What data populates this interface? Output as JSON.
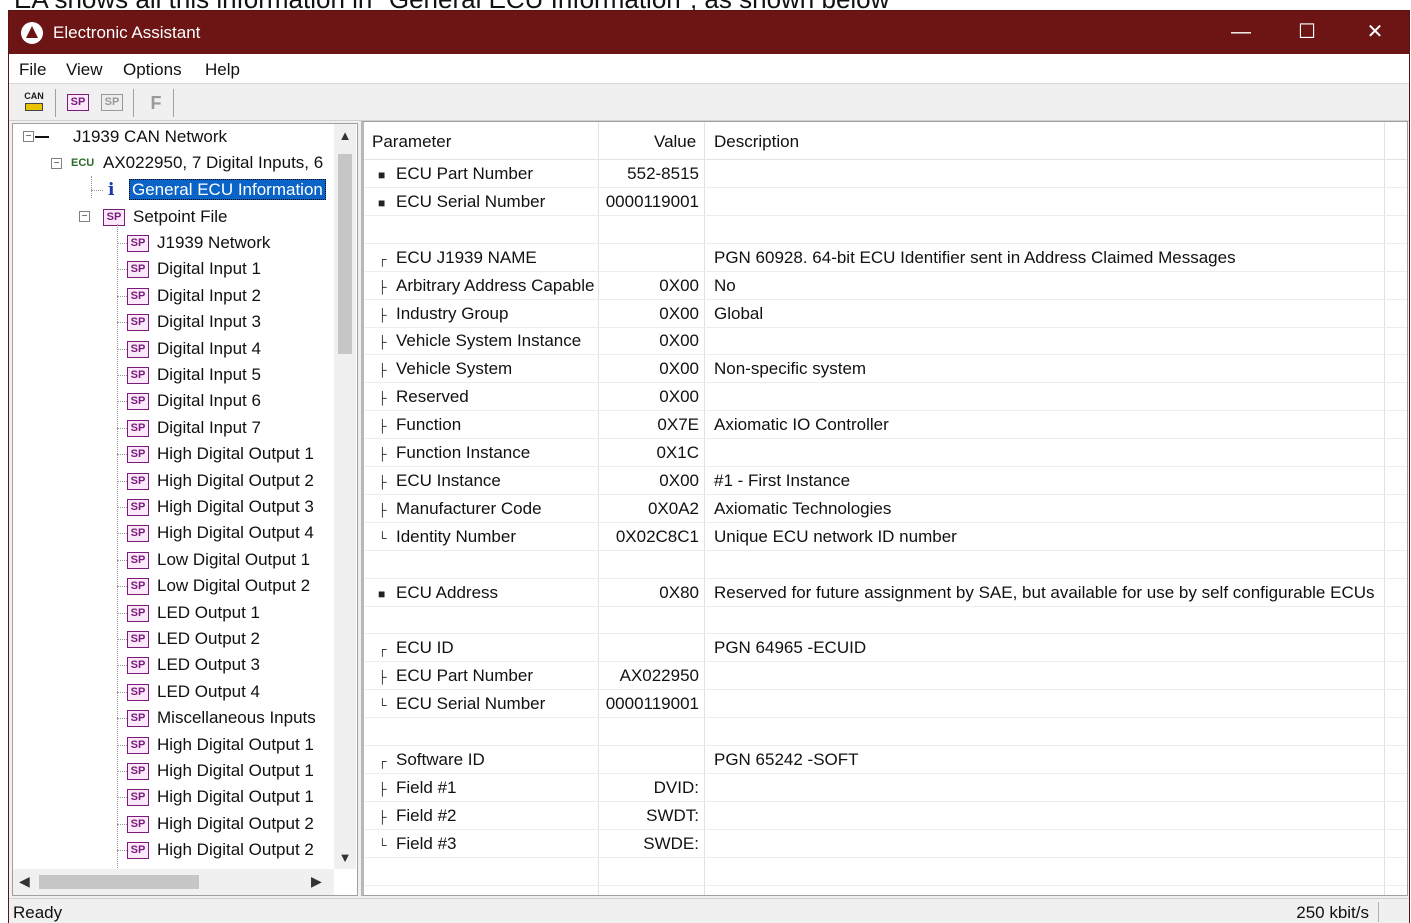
{
  "caption": "EA shows all this information in \"General ECU Information\", as shown below",
  "window": {
    "title": "Electronic Assistant",
    "minimize": "—",
    "maximize": "☐",
    "close": "✕"
  },
  "menu": [
    "File",
    "View",
    "Options",
    "Help"
  ],
  "toolbar": {
    "can_label": "CAN",
    "sp_label": "SP",
    "f_label": "F"
  },
  "tree": {
    "root": "J1939 CAN Network",
    "ecu_tag": "ECU",
    "ecu": "AX022950, 7 Digital Inputs, 6",
    "info_icon": "i",
    "general": "General ECU Information",
    "setpoint_file": "Setpoint File",
    "sp_icon": "SP",
    "items": [
      "J1939 Network",
      "Digital Input 1",
      "Digital Input 2",
      "Digital Input 3",
      "Digital Input 4",
      "Digital Input 5",
      "Digital Input 6",
      "Digital Input 7",
      "High Digital Output 1",
      "High Digital Output 2",
      "High Digital Output 3",
      "High Digital Output 4",
      "Low Digital Output 1",
      "Low Digital Output 2",
      "LED Output 1",
      "LED Output 2",
      "LED Output 3",
      "LED Output 4",
      "Miscellaneous Inputs",
      "High Digital Output 1",
      "High Digital Output 1",
      "High Digital Output 1",
      "High Digital Output 2",
      "High Digital Output 2"
    ]
  },
  "grid": {
    "headers": {
      "parameter": "Parameter",
      "value": "Value",
      "description": "Description"
    },
    "rows": [
      {
        "prefix": "■",
        "param": "ECU Part Number",
        "value": "552-8515",
        "desc": ""
      },
      {
        "prefix": "■",
        "param": "ECU Serial Number",
        "value": "0000119001",
        "desc": ""
      },
      {
        "prefix": "",
        "param": "",
        "value": "",
        "desc": ""
      },
      {
        "prefix": "┌",
        "param": "ECU J1939 NAME",
        "value": "",
        "desc": "PGN 60928. 64-bit ECU Identifier sent in Address Claimed Messages"
      },
      {
        "prefix": "├",
        "param": "Arbitrary Address Capable",
        "value": "0X00",
        "desc": "No"
      },
      {
        "prefix": "├",
        "param": "Industry Group",
        "value": "0X00",
        "desc": "Global"
      },
      {
        "prefix": "├",
        "param": "Vehicle System Instance",
        "value": "0X00",
        "desc": ""
      },
      {
        "prefix": "├",
        "param": "Vehicle System",
        "value": "0X00",
        "desc": "Non-specific system"
      },
      {
        "prefix": "├",
        "param": "Reserved",
        "value": "0X00",
        "desc": ""
      },
      {
        "prefix": "├",
        "param": "Function",
        "value": "0X7E",
        "desc": "Axiomatic IO Controller"
      },
      {
        "prefix": "├",
        "param": "Function Instance",
        "value": "0X1C",
        "desc": ""
      },
      {
        "prefix": "├",
        "param": "ECU Instance",
        "value": "0X00",
        "desc": "#1 - First Instance"
      },
      {
        "prefix": "├",
        "param": "Manufacturer Code",
        "value": "0X0A2",
        "desc": "Axiomatic Technologies"
      },
      {
        "prefix": "└",
        "param": "Identity Number",
        "value": "0X02C8C1",
        "desc": "Unique ECU network ID number"
      },
      {
        "prefix": "",
        "param": "",
        "value": "",
        "desc": ""
      },
      {
        "prefix": "■",
        "param": "ECU Address",
        "value": "0X80",
        "desc": "Reserved for future assignment by SAE, but available for use by self configurable ECUs"
      },
      {
        "prefix": "",
        "param": "",
        "value": "",
        "desc": ""
      },
      {
        "prefix": "┌",
        "param": "ECU ID",
        "value": "",
        "desc": "PGN 64965   -ECUID"
      },
      {
        "prefix": "├",
        "param": "ECU Part Number",
        "value": "AX022950",
        "desc": ""
      },
      {
        "prefix": "└",
        "param": "ECU Serial Number",
        "value": "0000119001",
        "desc": ""
      },
      {
        "prefix": "",
        "param": "",
        "value": "",
        "desc": ""
      },
      {
        "prefix": "┌",
        "param": "Software ID",
        "value": "",
        "desc": "PGN 65242   -SOFT"
      },
      {
        "prefix": "├",
        "param": "Field #1",
        "value": "DVID:",
        "desc": ""
      },
      {
        "prefix": "├",
        "param": "Field #2",
        "value": "SWDT:",
        "desc": ""
      },
      {
        "prefix": "└",
        "param": "Field #3",
        "value": "SWDE:",
        "desc": ""
      },
      {
        "prefix": "",
        "param": "",
        "value": "",
        "desc": ""
      },
      {
        "prefix": "",
        "param": "",
        "value": "",
        "desc": ""
      }
    ]
  },
  "status": {
    "left": "Ready",
    "right": "250 kbit/s"
  },
  "scroll": {
    "up": "▲",
    "down": "▼",
    "left": "◀",
    "right": "▶"
  },
  "colors": {
    "titlebar": "#6d1414",
    "selection": "#0a64c8",
    "sp_icon": "#7a1a7a"
  }
}
